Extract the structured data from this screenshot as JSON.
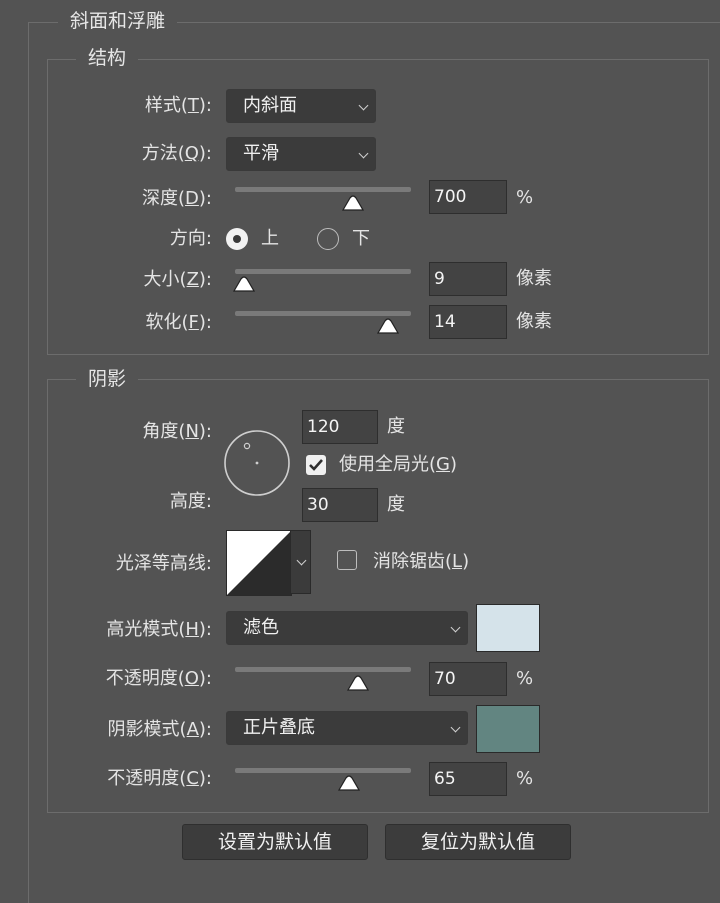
{
  "title": "斜面和浮雕",
  "structure": {
    "title": "结构",
    "style": {
      "label": "样式",
      "key": "T",
      "value": "内斜面"
    },
    "technique": {
      "label": "方法",
      "key": "Q",
      "value": "平滑"
    },
    "depth": {
      "label": "深度",
      "key": "D",
      "value": "700",
      "unit": "%",
      "fraction": 0.67
    },
    "direction": {
      "label": "方向:",
      "up_label": "上",
      "down_label": "下",
      "selected": "上"
    },
    "size": {
      "label": "大小",
      "key": "Z",
      "value": "9",
      "unit": "像素",
      "fraction": 0.05
    },
    "soften": {
      "label": "软化",
      "key": "F",
      "value": "14",
      "unit": "像素",
      "fraction": 0.87
    }
  },
  "shading": {
    "title": "阴影",
    "angle": {
      "label": "角度",
      "key": "N",
      "value": "120",
      "unit": "度"
    },
    "global_light": {
      "label": "使用全局光",
      "key": "G",
      "checked": true
    },
    "altitude": {
      "label": "高度:",
      "value": "30",
      "unit": "度"
    },
    "gloss_contour": {
      "label": "光泽等高线:"
    },
    "anti_aliased": {
      "label": "消除锯齿",
      "key": "L",
      "checked": false
    },
    "highlight_mode": {
      "label": "高光模式",
      "key": "H",
      "value": "滤色",
      "color": "#d5e3ea"
    },
    "highlight_opacity": {
      "label": "不透明度",
      "key": "O",
      "value": "70",
      "unit": "%",
      "fraction": 0.7
    },
    "shadow_mode": {
      "label": "阴影模式",
      "key": "A",
      "value": "正片叠底",
      "color": "#628581"
    },
    "shadow_opacity": {
      "label": "不透明度",
      "key": "C",
      "value": "65",
      "unit": "%",
      "fraction": 0.65
    }
  },
  "buttons": {
    "make_default": "设置为默认值",
    "reset_default": "复位为默认值"
  },
  "colors": {
    "background": "#535353",
    "field": "#3b3b3b"
  }
}
